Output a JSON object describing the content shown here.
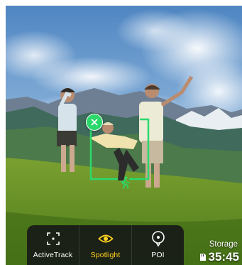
{
  "modes": [
    {
      "label": "ActiveTrack",
      "icon": "activetrack-frame-icon",
      "active": false
    },
    {
      "label": "Spotlight",
      "icon": "eye-icon",
      "active": true
    },
    {
      "label": "POI",
      "icon": "poi-pin-icon",
      "active": false
    }
  ],
  "tracking": {
    "color": "#2bd96b",
    "cancel_icon": "close-icon",
    "subject_icon": "running-person-icon"
  },
  "storage": {
    "label": "Storage",
    "value": "35:45",
    "icon": "sd-card-icon"
  },
  "colors": {
    "active_mode": "#ffd21f",
    "tracking_green": "#2bd96b",
    "bar_background": "#141416"
  }
}
